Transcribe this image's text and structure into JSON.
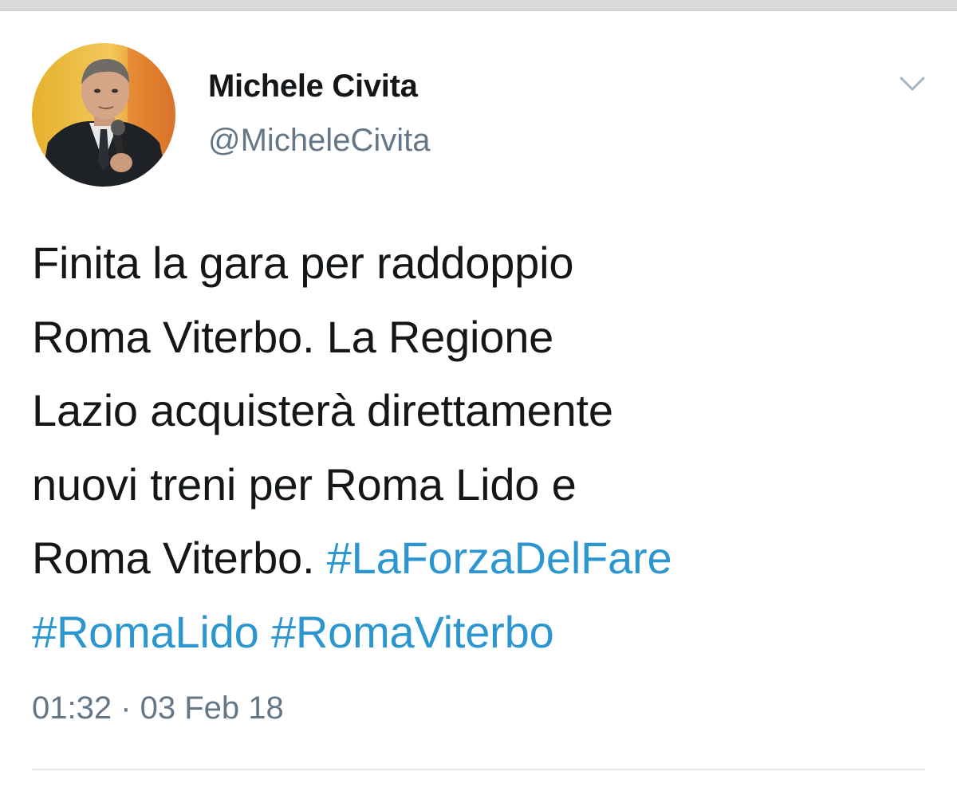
{
  "author": {
    "name": "Michele Civita",
    "handle": "@MicheleCivita"
  },
  "tweet": {
    "lines": [
      "Finita la gara per raddoppio",
      "Roma Viterbo. La Regione",
      "Lazio acquisterà direttamente",
      "nuovi treni per Roma Lido e",
      "Roma Viterbo."
    ],
    "hashtags": [
      "#LaForzaDelFare",
      "#RomaLido",
      "#RomaViterbo"
    ],
    "timestamp": "01:32 · 03 Feb 18"
  },
  "icons": {
    "menu": "chevron-down-icon",
    "avatar": "profile-photo"
  },
  "colors": {
    "text": "#14171a",
    "secondary": "#657786",
    "hashtag": "#2b96cf",
    "divider": "#e1e8ed"
  }
}
